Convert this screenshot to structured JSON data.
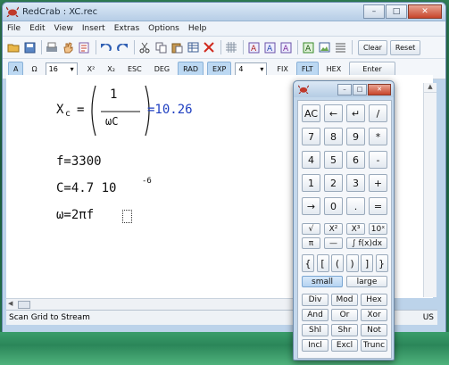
{
  "window": {
    "title": "RedCrab : XC.rec",
    "controls": [
      "–",
      "□",
      "✕"
    ]
  },
  "menu": [
    "File",
    "Edit",
    "View",
    "Insert",
    "Extras",
    "Options",
    "Help"
  ],
  "toolbar1": {
    "clear_label": "Clear",
    "reset_label": "Reset",
    "icons": [
      "open-icon",
      "save-icon",
      "print-icon",
      "hand-icon",
      "properties-icon",
      "undo-icon",
      "redo-icon",
      "cut-icon",
      "copy-icon",
      "paste-icon",
      "table-icon",
      "delete-icon",
      "grid-icon",
      "font-a-icon",
      "font-b-icon",
      "font-c-icon",
      "text-a-icon",
      "image-icon",
      "lines-icon"
    ]
  },
  "toolbar2": {
    "a_label": "A",
    "omega_label": "Ω",
    "font_size": "16",
    "x_sup_label": "X²",
    "x_sub_label": "X₂",
    "esc_label": "ESC",
    "deg_label": "DEG",
    "rad_label": "RAD",
    "exp_label": "EXP",
    "digits": "4",
    "fix_label": "FIX",
    "flt_label": "FLT",
    "hex_label": "HEX",
    "enter_label": "Enter"
  },
  "document": {
    "formula_lhs": "X",
    "formula_sub": "c",
    "formula_eq": "=",
    "frac_num": "1",
    "frac_den": "ωC",
    "result": "=10.26",
    "line_f": "f=3300",
    "line_c": "C=4.7 10",
    "line_c_exp": "-6",
    "line_omega": "ω=2πf"
  },
  "status": {
    "text": "Scan Grid to Stream",
    "lang": "US"
  },
  "calculator": {
    "rows": [
      [
        "AC",
        "←",
        "↵",
        "/"
      ],
      [
        "7",
        "8",
        "9",
        "*"
      ],
      [
        "4",
        "5",
        "6",
        "-"
      ],
      [
        "1",
        "2",
        "3",
        "+"
      ],
      [
        "→",
        "0",
        ".",
        "="
      ]
    ],
    "func_row1": [
      "√",
      "X²",
      "X³",
      "10ˣ"
    ],
    "func_row2": [
      "π",
      "—",
      "∫ f(x)dx"
    ],
    "brackets": [
      "{",
      "[",
      "(",
      ")",
      "]",
      "}"
    ],
    "small_label": "small",
    "large_label": "large",
    "ops": [
      [
        "Div",
        "Mod",
        "Hex"
      ],
      [
        "And",
        "Or",
        "Xor"
      ],
      [
        "Shl",
        "Shr",
        "Not"
      ],
      [
        "Incl",
        "Excl",
        "Trunc"
      ]
    ]
  }
}
